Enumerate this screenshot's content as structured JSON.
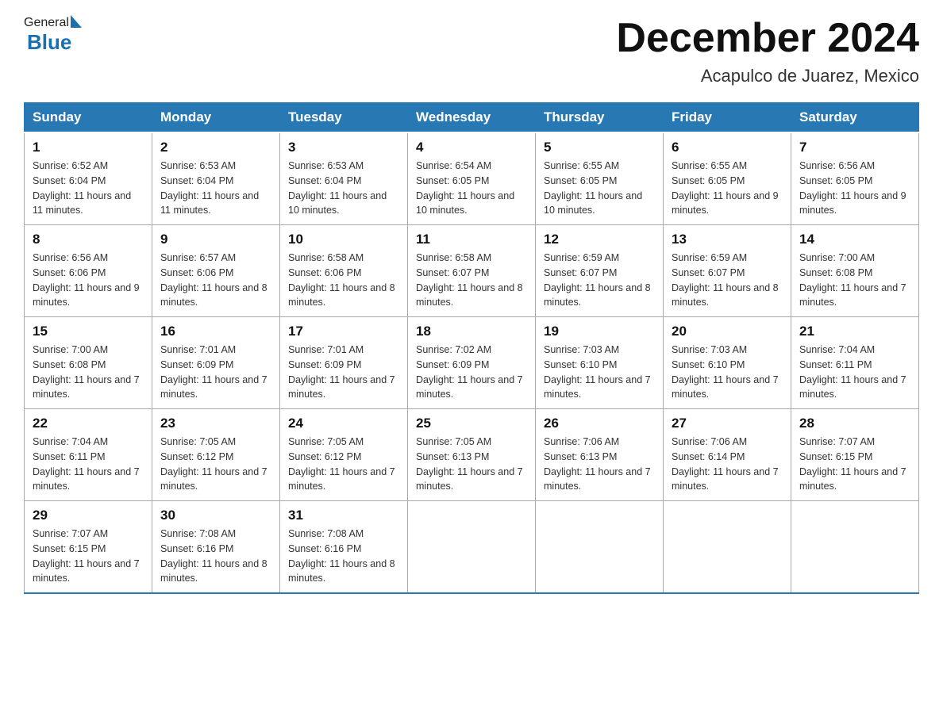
{
  "logo": {
    "general": "General",
    "blue": "Blue"
  },
  "title": "December 2024",
  "subtitle": "Acapulco de Juarez, Mexico",
  "days": {
    "headers": [
      "Sunday",
      "Monday",
      "Tuesday",
      "Wednesday",
      "Thursday",
      "Friday",
      "Saturday"
    ]
  },
  "weeks": [
    [
      {
        "day": "1",
        "sunrise": "6:52 AM",
        "sunset": "6:04 PM",
        "daylight": "11 hours and 11 minutes."
      },
      {
        "day": "2",
        "sunrise": "6:53 AM",
        "sunset": "6:04 PM",
        "daylight": "11 hours and 11 minutes."
      },
      {
        "day": "3",
        "sunrise": "6:53 AM",
        "sunset": "6:04 PM",
        "daylight": "11 hours and 10 minutes."
      },
      {
        "day": "4",
        "sunrise": "6:54 AM",
        "sunset": "6:05 PM",
        "daylight": "11 hours and 10 minutes."
      },
      {
        "day": "5",
        "sunrise": "6:55 AM",
        "sunset": "6:05 PM",
        "daylight": "11 hours and 10 minutes."
      },
      {
        "day": "6",
        "sunrise": "6:55 AM",
        "sunset": "6:05 PM",
        "daylight": "11 hours and 9 minutes."
      },
      {
        "day": "7",
        "sunrise": "6:56 AM",
        "sunset": "6:05 PM",
        "daylight": "11 hours and 9 minutes."
      }
    ],
    [
      {
        "day": "8",
        "sunrise": "6:56 AM",
        "sunset": "6:06 PM",
        "daylight": "11 hours and 9 minutes."
      },
      {
        "day": "9",
        "sunrise": "6:57 AM",
        "sunset": "6:06 PM",
        "daylight": "11 hours and 8 minutes."
      },
      {
        "day": "10",
        "sunrise": "6:58 AM",
        "sunset": "6:06 PM",
        "daylight": "11 hours and 8 minutes."
      },
      {
        "day": "11",
        "sunrise": "6:58 AM",
        "sunset": "6:07 PM",
        "daylight": "11 hours and 8 minutes."
      },
      {
        "day": "12",
        "sunrise": "6:59 AM",
        "sunset": "6:07 PM",
        "daylight": "11 hours and 8 minutes."
      },
      {
        "day": "13",
        "sunrise": "6:59 AM",
        "sunset": "6:07 PM",
        "daylight": "11 hours and 8 minutes."
      },
      {
        "day": "14",
        "sunrise": "7:00 AM",
        "sunset": "6:08 PM",
        "daylight": "11 hours and 7 minutes."
      }
    ],
    [
      {
        "day": "15",
        "sunrise": "7:00 AM",
        "sunset": "6:08 PM",
        "daylight": "11 hours and 7 minutes."
      },
      {
        "day": "16",
        "sunrise": "7:01 AM",
        "sunset": "6:09 PM",
        "daylight": "11 hours and 7 minutes."
      },
      {
        "day": "17",
        "sunrise": "7:01 AM",
        "sunset": "6:09 PM",
        "daylight": "11 hours and 7 minutes."
      },
      {
        "day": "18",
        "sunrise": "7:02 AM",
        "sunset": "6:09 PM",
        "daylight": "11 hours and 7 minutes."
      },
      {
        "day": "19",
        "sunrise": "7:03 AM",
        "sunset": "6:10 PM",
        "daylight": "11 hours and 7 minutes."
      },
      {
        "day": "20",
        "sunrise": "7:03 AM",
        "sunset": "6:10 PM",
        "daylight": "11 hours and 7 minutes."
      },
      {
        "day": "21",
        "sunrise": "7:04 AM",
        "sunset": "6:11 PM",
        "daylight": "11 hours and 7 minutes."
      }
    ],
    [
      {
        "day": "22",
        "sunrise": "7:04 AM",
        "sunset": "6:11 PM",
        "daylight": "11 hours and 7 minutes."
      },
      {
        "day": "23",
        "sunrise": "7:05 AM",
        "sunset": "6:12 PM",
        "daylight": "11 hours and 7 minutes."
      },
      {
        "day": "24",
        "sunrise": "7:05 AM",
        "sunset": "6:12 PM",
        "daylight": "11 hours and 7 minutes."
      },
      {
        "day": "25",
        "sunrise": "7:05 AM",
        "sunset": "6:13 PM",
        "daylight": "11 hours and 7 minutes."
      },
      {
        "day": "26",
        "sunrise": "7:06 AM",
        "sunset": "6:13 PM",
        "daylight": "11 hours and 7 minutes."
      },
      {
        "day": "27",
        "sunrise": "7:06 AM",
        "sunset": "6:14 PM",
        "daylight": "11 hours and 7 minutes."
      },
      {
        "day": "28",
        "sunrise": "7:07 AM",
        "sunset": "6:15 PM",
        "daylight": "11 hours and 7 minutes."
      }
    ],
    [
      {
        "day": "29",
        "sunrise": "7:07 AM",
        "sunset": "6:15 PM",
        "daylight": "11 hours and 7 minutes."
      },
      {
        "day": "30",
        "sunrise": "7:08 AM",
        "sunset": "6:16 PM",
        "daylight": "11 hours and 8 minutes."
      },
      {
        "day": "31",
        "sunrise": "7:08 AM",
        "sunset": "6:16 PM",
        "daylight": "11 hours and 8 minutes."
      },
      null,
      null,
      null,
      null
    ]
  ]
}
